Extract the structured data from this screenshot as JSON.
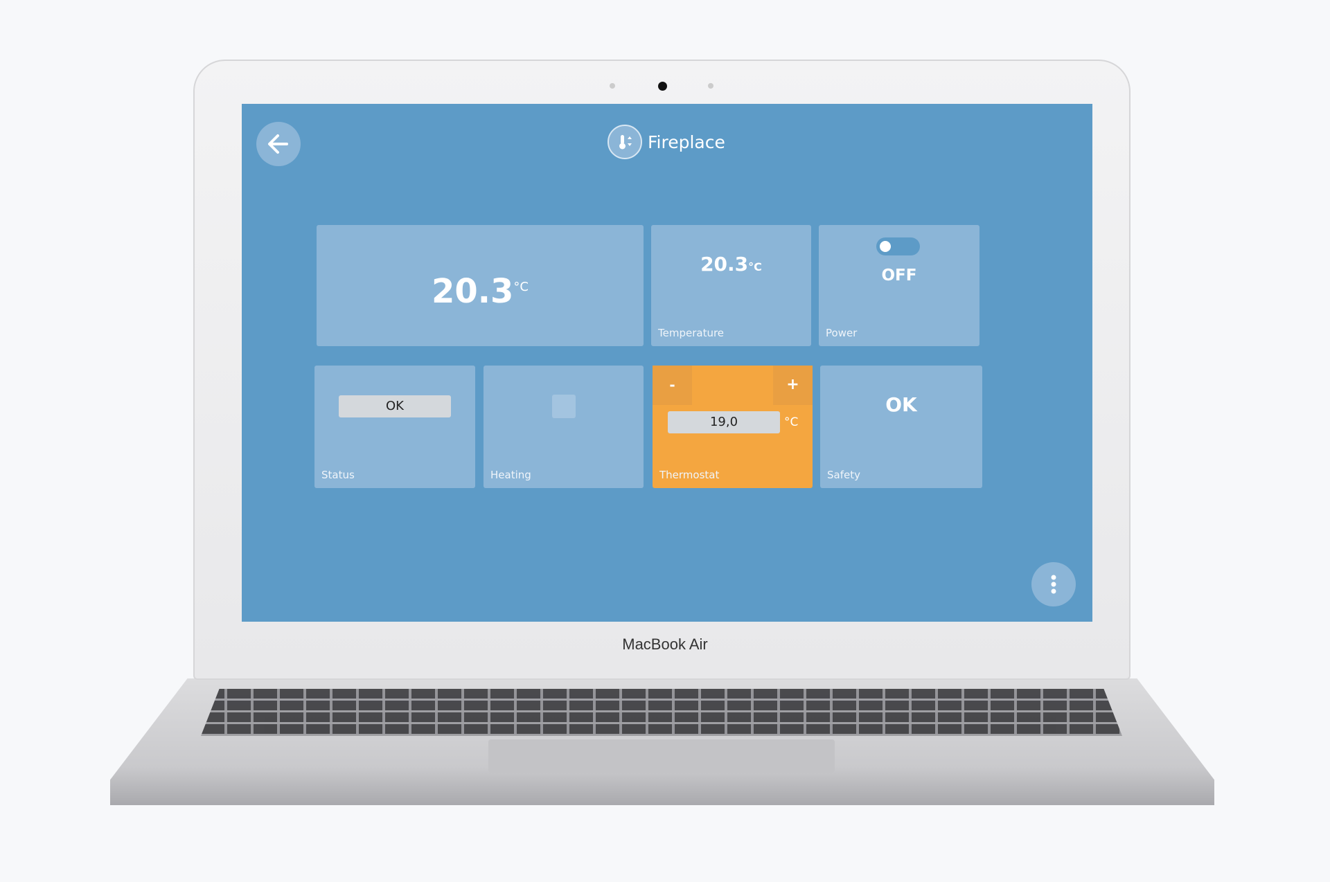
{
  "device": {
    "brand_label": "MacBook Air"
  },
  "header": {
    "title": "Fireplace",
    "back_icon": "arrow-left-icon",
    "title_icon": "thermometer-icon",
    "menu_icon": "vertical-dots-icon"
  },
  "colors": {
    "background": "#5d9bc7",
    "tile": "#8bb5d7",
    "accent": "#f4a640"
  },
  "tiles": {
    "main": {
      "value": "20.3",
      "unit": "°C"
    },
    "temperature": {
      "value": "20.3",
      "unit": "°C",
      "label": "Temperature"
    },
    "power": {
      "state": "OFF",
      "toggle_on": false,
      "label": "Power"
    },
    "status": {
      "value": "OK",
      "label": "Status"
    },
    "heating": {
      "label": "Heating",
      "checked": false
    },
    "thermostat": {
      "minus": "-",
      "plus": "+",
      "value": "19,0",
      "unit": "°C",
      "label": "Thermostat"
    },
    "safety": {
      "value": "OK",
      "label": "Safety"
    }
  }
}
